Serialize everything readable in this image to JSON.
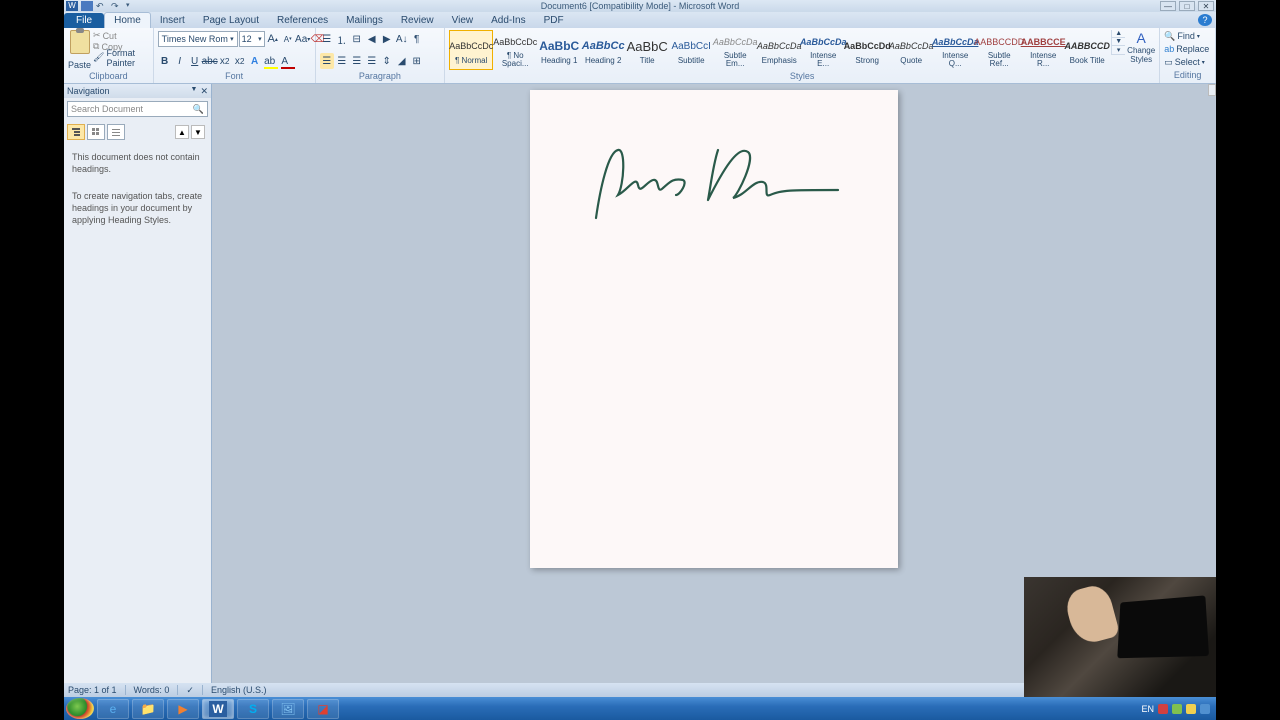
{
  "titlebar": {
    "title": "Document6 [Compatibility Mode] - Microsoft Word"
  },
  "tabs": {
    "file": "File",
    "home": "Home",
    "insert": "Insert",
    "pagelayout": "Page Layout",
    "references": "References",
    "mailings": "Mailings",
    "review": "Review",
    "view": "View",
    "addins": "Add-Ins",
    "pdf": "PDF"
  },
  "ribbon": {
    "clipboard": {
      "label": "Clipboard",
      "paste": "Paste",
      "cut": "Cut",
      "copy": "Copy",
      "formatpainter": "Format Painter"
    },
    "font": {
      "label": "Font",
      "name": "Times New Rom",
      "size": "12"
    },
    "paragraph": {
      "label": "Paragraph"
    },
    "styles": {
      "label": "Styles",
      "items": [
        {
          "preview": "AaBbCcDc",
          "name": "¶ Normal",
          "cls": "n"
        },
        {
          "preview": "AaBbCcDc",
          "name": "¶ No Spaci...",
          "cls": "n"
        },
        {
          "preview": "AaBbC",
          "name": "Heading 1",
          "cls": "h1"
        },
        {
          "preview": "AaBbCc",
          "name": "Heading 2",
          "cls": "h2"
        },
        {
          "preview": "AaBbC",
          "name": "Title",
          "cls": "ti"
        },
        {
          "preview": "AaBbCcI",
          "name": "Subtitle",
          "cls": "st"
        },
        {
          "preview": "AaBbCcDa",
          "name": "Subtle Em...",
          "cls": "se"
        },
        {
          "preview": "AaBbCcDa",
          "name": "Emphasis",
          "cls": "em"
        },
        {
          "preview": "AaBbCcDa",
          "name": "Intense E...",
          "cls": "ie"
        },
        {
          "preview": "AaBbCcDd",
          "name": "Strong",
          "cls": "str"
        },
        {
          "preview": "AaBbCcDa",
          "name": "Quote",
          "cls": "q"
        },
        {
          "preview": "AaBbCcDa",
          "name": "Intense Q...",
          "cls": "iq"
        },
        {
          "preview": "AABBCCDD",
          "name": "Subtle Ref...",
          "cls": "sr"
        },
        {
          "preview": "AABBCCE",
          "name": "Intense R...",
          "cls": "ir"
        },
        {
          "preview": "AABBCCD",
          "name": "Book Title",
          "cls": "bt"
        }
      ],
      "change": "Change Styles"
    },
    "editing": {
      "label": "Editing",
      "find": "Find",
      "replace": "Replace",
      "select": "Select"
    }
  },
  "nav": {
    "title": "Navigation",
    "search": "Search Document",
    "msg1": "This document does not contain headings.",
    "msg2": "To create navigation tabs, create headings in your document by applying Heading Styles."
  },
  "document": {
    "signature": "Jane Doe"
  },
  "status": {
    "page": "Page: 1 of 1",
    "words": "Words: 0",
    "lang": "English (U.S.)"
  },
  "tray": {
    "lang": "EN"
  }
}
